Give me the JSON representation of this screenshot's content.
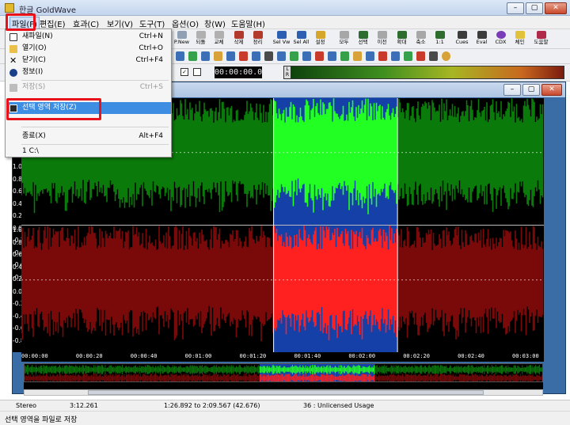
{
  "window": {
    "title": "한글 GoldWave",
    "buttons": [
      "–",
      "▢",
      "✕"
    ]
  },
  "menubar": {
    "items": [
      "파일(F)",
      "편집(E)",
      "효과(C)",
      "보기(V)",
      "도구(T)",
      "옵션(O)",
      "창(W)",
      "도움말(H)"
    ],
    "active_index": 0
  },
  "toolbar": {
    "buttons": [
      {
        "label": "P.New",
        "icon": "new-file-icon"
      },
      {
        "label": "되돌",
        "icon": "undo-icon"
      },
      {
        "label": "교체",
        "icon": "replace-icon"
      },
      {
        "label": "삭제",
        "icon": "delete-icon"
      },
      {
        "label": "정리",
        "icon": "trim-icon"
      },
      {
        "label": "Sel Vw",
        "icon": "select-view-icon"
      },
      {
        "label": "Sel All",
        "icon": "select-all-icon"
      },
      {
        "label": "설정",
        "icon": "set-icon"
      },
      {
        "label": "모두",
        "icon": "zoom-all-icon"
      },
      {
        "label": "선택",
        "icon": "zoom-select-icon"
      },
      {
        "label": "이전",
        "icon": "zoom-previous-icon"
      },
      {
        "label": "확대",
        "icon": "zoom-in-icon"
      },
      {
        "label": "축소",
        "icon": "zoom-out-icon"
      },
      {
        "label": "1:1",
        "icon": "zoom-1-1-icon"
      },
      {
        "label": "Cues",
        "icon": "cues-icon"
      },
      {
        "label": "Eval",
        "icon": "eval-icon"
      },
      {
        "label": "CDX",
        "icon": "cd-icon"
      },
      {
        "label": "체인",
        "icon": "chain-icon"
      },
      {
        "label": "도움말",
        "icon": "help-book-icon"
      }
    ]
  },
  "transport": {
    "time": "00:00:00.0",
    "meter_label": "L R",
    "check": "✓"
  },
  "file_menu": {
    "items": [
      {
        "label": "새파일(N)",
        "shortcut": "Ctrl+N",
        "icon": "new-file-icon",
        "disabled": false
      },
      {
        "label": "열기(O)",
        "shortcut": "Ctrl+O",
        "icon": "folder-open-icon",
        "disabled": false
      },
      {
        "label": "닫기(C)",
        "shortcut": "Ctrl+F4",
        "icon": "close-x-icon",
        "disabled": false
      },
      {
        "label": "정보(I)",
        "shortcut": "",
        "icon": "info-icon",
        "disabled": false
      },
      {
        "label": "저장(S)",
        "shortcut": "Ctrl+S",
        "icon": "save-icon",
        "disabled": true
      },
      {
        "label": "선택 영역 저장(Z)",
        "shortcut": "",
        "icon": "save-selection-icon",
        "disabled": false,
        "selected": true
      },
      {
        "label": "종료(X)",
        "shortcut": "Alt+F4",
        "icon": "",
        "disabled": false
      },
      {
        "label": "1 C:\\",
        "shortcut": "",
        "icon": "",
        "disabled": false
      }
    ]
  },
  "waveform": {
    "y_ticks_top": [
      "1.0",
      "0.8",
      "0.6",
      "0.4",
      "0.2",
      "0.0",
      "-0.2",
      "-0.4",
      "-0.6",
      "-0.8"
    ],
    "y_ticks_bottom": [
      "1.0",
      "0.8",
      "0.6",
      "0.4",
      "0.2",
      "0.0",
      "-0.2",
      "-0.4",
      "-0.6",
      "-0.8"
    ],
    "timeline": [
      "00:00:00",
      "00:00:20",
      "00:00:40",
      "00:01:00",
      "00:01:20",
      "00:01:40",
      "00:02:00",
      "00:02:20",
      "00:02:40",
      "00:03:00"
    ],
    "selection_start": "1:26.892",
    "selection_end": "2:09.567",
    "colors": {
      "left_channel": "#0a7a0a",
      "left_selected": "#22ff22",
      "right_channel": "#7a0a0a",
      "right_selected": "#ff2020",
      "selection_bg": "#1540a8"
    }
  },
  "status": {
    "channels": "Stereo",
    "length": "3:12.261",
    "selection": "1:26.892 to 2:09.567 (42.676)",
    "license": "36 : Unlicensed Usage"
  },
  "hint": "선택 영역을 파일로 저장"
}
